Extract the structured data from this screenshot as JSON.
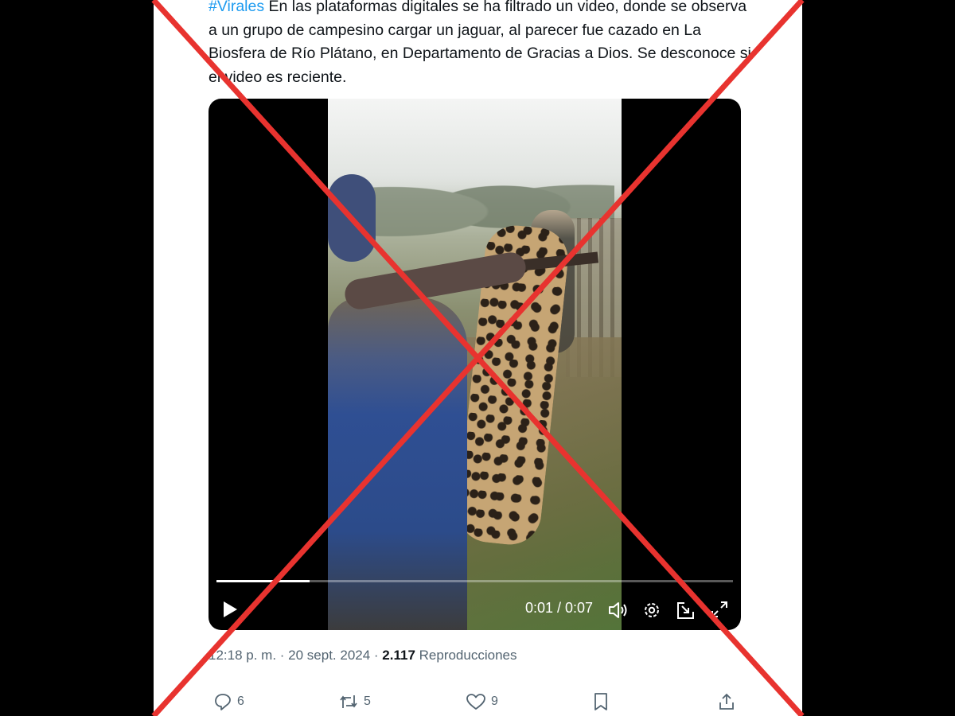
{
  "tweet": {
    "hashtag": "#Virales",
    "text": " En las plataformas digitales se ha filtrado un video, donde se observa a un grupo de campesino cargar un jaguar, al parecer fue cazado en  La Biosfera de Río Plátano, en Departamento de Gracias a Dios. Se desconoce si el video es reciente."
  },
  "video": {
    "progress": 0.18,
    "time_display": "0:01 / 0:07"
  },
  "meta": {
    "timestamp": "12:18 p. m. · 20 sept. 2024 · ",
    "views_count": "2.117",
    "views_label": " Reproducciones"
  },
  "actions": {
    "replies": "6",
    "reposts": "5",
    "likes": "9"
  },
  "overlay": {
    "cross_color": "#e8332f",
    "meaning": "false-content-x"
  },
  "colors": {
    "link": "#1d9bf0",
    "text": "#0f1419",
    "muted": "#536471"
  }
}
